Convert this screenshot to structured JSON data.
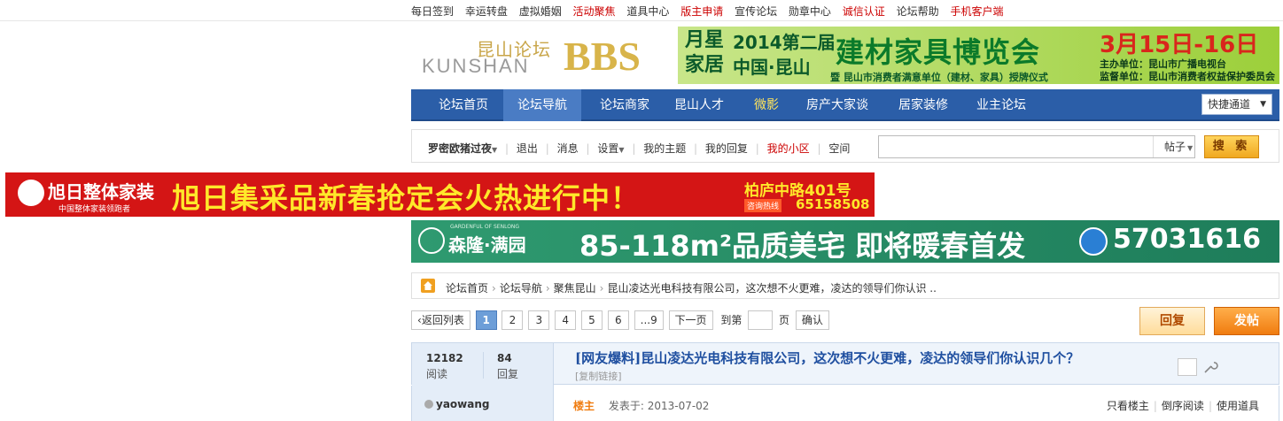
{
  "topbar": {
    "links": [
      {
        "label": "每日签到",
        "red": false
      },
      {
        "label": "幸运转盘",
        "red": false
      },
      {
        "label": "虚拟婚姻",
        "red": false
      },
      {
        "label": "活动聚焦",
        "red": true
      },
      {
        "label": "道具中心",
        "red": false
      },
      {
        "label": "版主申请",
        "red": true
      },
      {
        "label": "宣传论坛",
        "red": false
      },
      {
        "label": "勋章中心",
        "red": false
      },
      {
        "label": "诚信认证",
        "red": true
      },
      {
        "label": "论坛帮助",
        "red": false
      },
      {
        "label": "手机客户端",
        "red": true
      }
    ]
  },
  "logo": {
    "cn": "昆山论坛",
    "en": "KUNSHAN",
    "bbs": "BBS"
  },
  "ad_top": {
    "brand": "月星家居",
    "line1": "2014第二届",
    "line2": "中国·昆山",
    "expo": "建材家具博览会",
    "sub": "暨 昆山市消费者满意单位（建材、家具）授牌仪式",
    "date": "3月15日-16日",
    "host1": "主办单位：昆山市广播电视台",
    "host2": "监督单位：昆山市消费者权益保护委员会"
  },
  "nav": {
    "items": [
      "论坛首页",
      "论坛导航",
      "论坛商家",
      "昆山人才",
      "微影",
      "房产大家谈",
      "居家装修",
      "业主论坛"
    ],
    "quick": "快捷通道"
  },
  "userbar": {
    "username": "罗密欧猪过夜",
    "links": [
      "退出",
      "消息",
      "设置"
    ],
    "links2": [
      "我的主题",
      "我的回复",
      "我的小区",
      "空间"
    ],
    "search_type": "帖子",
    "search_btn": "搜 索",
    "search_placeholder": ""
  },
  "ad_mid": {
    "brand": "旭日整体家装",
    "brand_sub": "中国整体家装领跑者",
    "slogan": "旭日集采品新春抢定会火热进行中！",
    "addr": "柏庐中路401号",
    "hotline_label": "咨询热线",
    "hotline": "65158508"
  },
  "ad_mid2": {
    "brand": "森隆·满园",
    "brand_sub": "GARDENFUL OF SENLONG",
    "slogan": "85-118m²品质美宅 即将暖春首发",
    "phone": "57031616"
  },
  "breadcrumb": {
    "items": [
      "论坛首页",
      "论坛导航",
      "聚焦昆山",
      "昆山凌达光电科技有限公司，这次想不火更难，凌达的领导们你认识 .."
    ]
  },
  "pager": {
    "back": "返回列表",
    "pages": [
      "1",
      "2",
      "3",
      "4",
      "5",
      "6"
    ],
    "last": "...9",
    "next": "下一页",
    "goto_label": "到第",
    "page_label": "页",
    "confirm": "确认"
  },
  "actions": {
    "reply": "回复",
    "post": "发帖"
  },
  "thread": {
    "views": "12182",
    "views_label": "阅读",
    "replies": "84",
    "replies_label": "回复",
    "title": "[网友爆料]昆山凌达光电科技有限公司，这次想不火更难，凌达的领导们你认识几个？",
    "copy_link": "[复制链接]"
  },
  "post": {
    "author": "yaowang",
    "lz": "楼主",
    "date": "发表于: 2013-07-02",
    "tools": [
      "只看楼主",
      "倒序阅读",
      "使用道具"
    ]
  },
  "colors": {
    "nav_bg": "#2b5ea8",
    "accent_red": "#cc0000",
    "orange": "#f07c10"
  }
}
